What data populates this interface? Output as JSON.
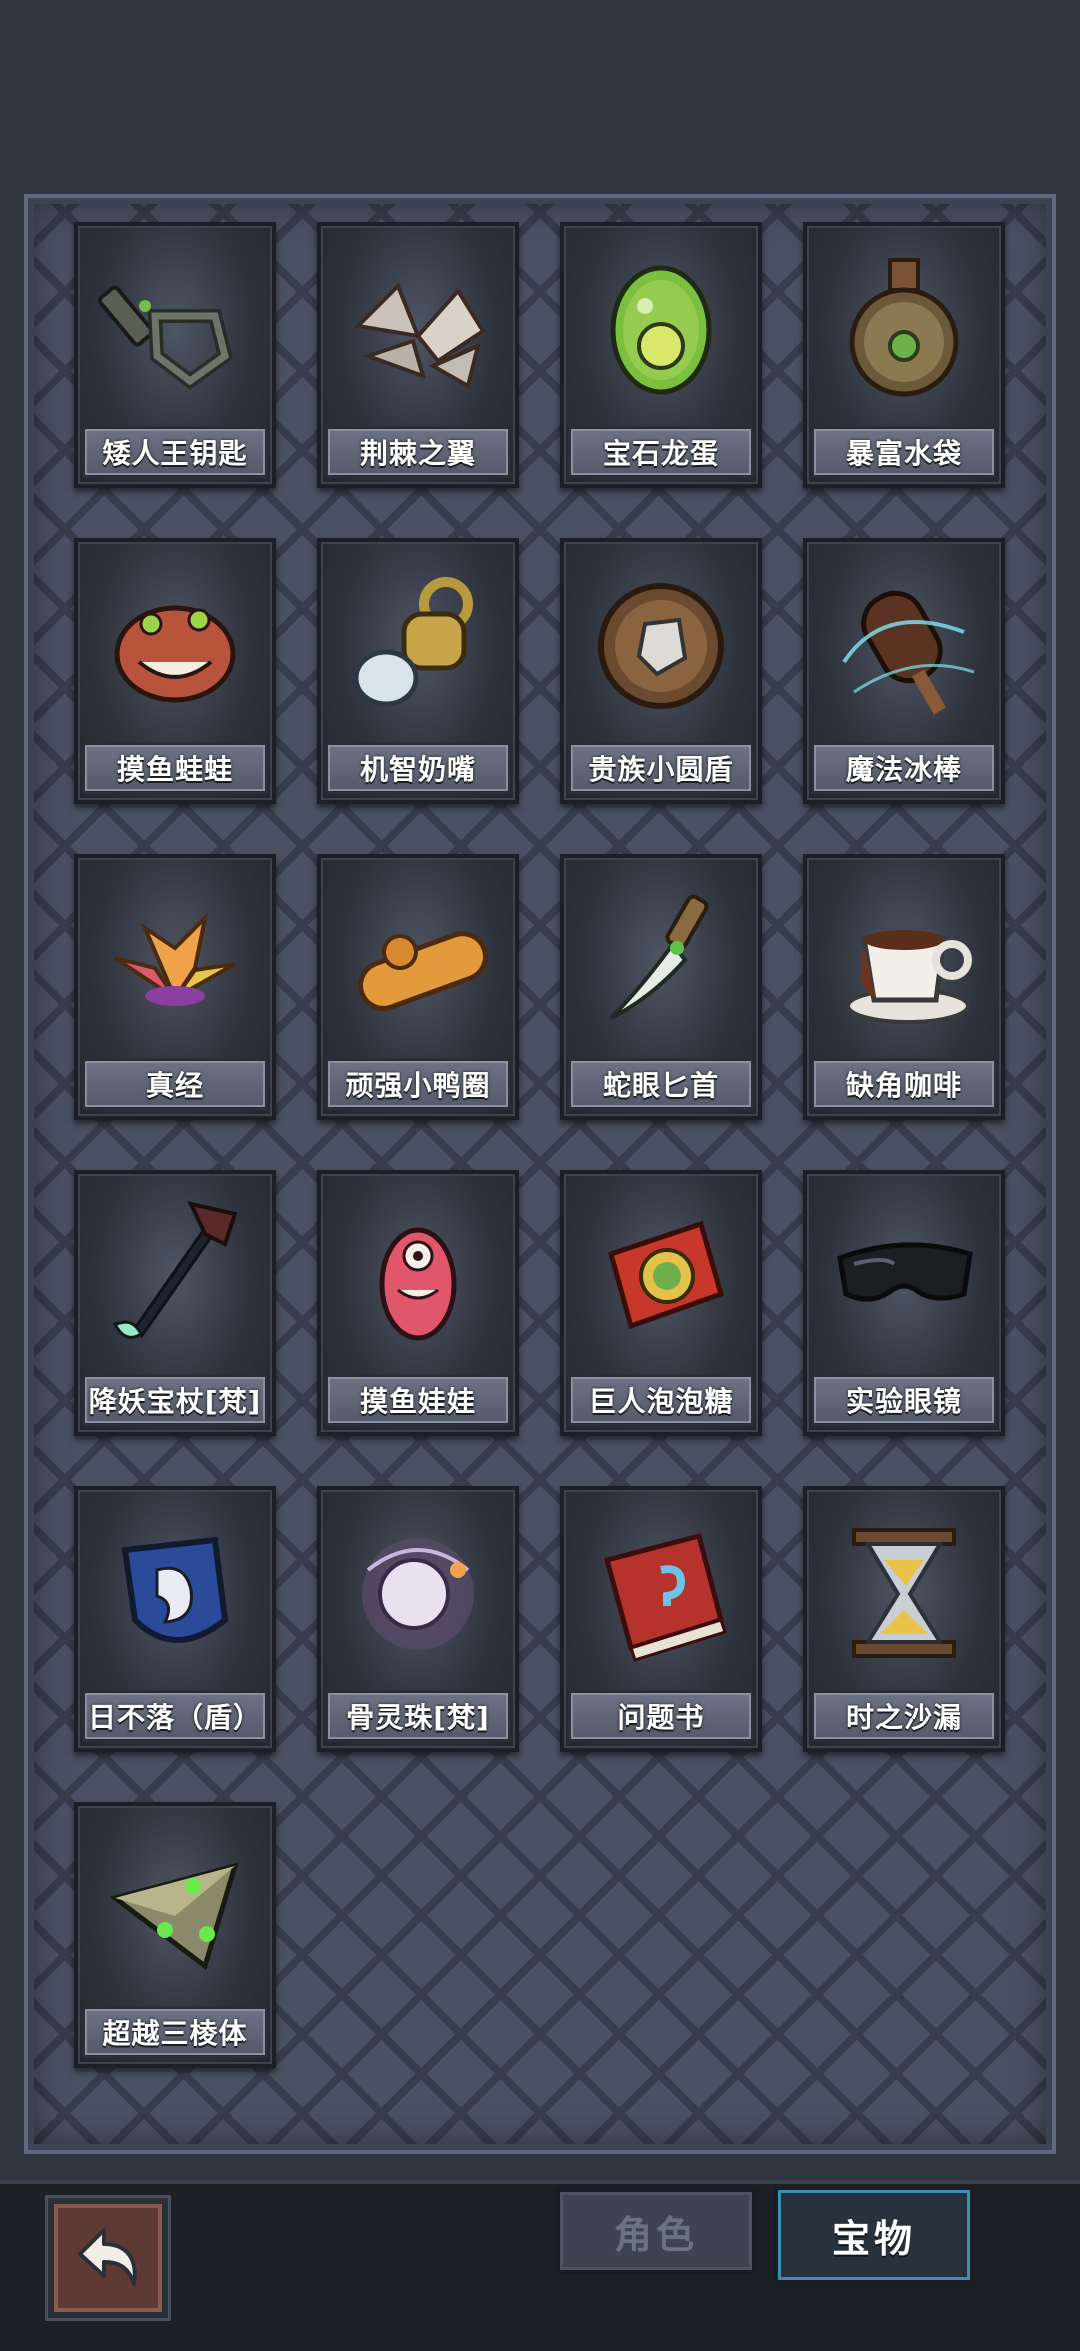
{
  "items": [
    {
      "label": "矮人王钥匙",
      "icon": "dwarf-key-icon"
    },
    {
      "label": "荆棘之翼",
      "icon": "thorn-wings-icon"
    },
    {
      "label": "宝石龙蛋",
      "icon": "gem-dragon-egg-icon"
    },
    {
      "label": "暴富水袋",
      "icon": "water-flask-icon"
    },
    {
      "label": "摸鱼蛙蛙",
      "icon": "slacker-frog-icon"
    },
    {
      "label": "机智奶嘴",
      "icon": "pacifier-icon"
    },
    {
      "label": "贵族小圆盾",
      "icon": "round-shield-icon"
    },
    {
      "label": "魔法冰棒",
      "icon": "magic-popsicle-icon"
    },
    {
      "label": "真经",
      "icon": "lotus-icon"
    },
    {
      "label": "顽强小鸭圈",
      "icon": "duck-ring-icon"
    },
    {
      "label": "蛇眼匕首",
      "icon": "snake-eye-dagger-icon"
    },
    {
      "label": "缺角咖啡",
      "icon": "chipped-coffee-icon"
    },
    {
      "label": "降妖宝杖[梵]",
      "icon": "demon-staff-icon"
    },
    {
      "label": "摸鱼娃娃",
      "icon": "slacker-doll-icon"
    },
    {
      "label": "巨人泡泡糖",
      "icon": "bubble-gum-icon"
    },
    {
      "label": "实验眼镜",
      "icon": "lab-goggles-icon"
    },
    {
      "label": "日不落（盾）",
      "icon": "lion-shield-icon"
    },
    {
      "label": "骨灵珠[梵]",
      "icon": "bone-orb-icon"
    },
    {
      "label": "问题书",
      "icon": "question-book-icon"
    },
    {
      "label": "时之沙漏",
      "icon": "hourglass-icon"
    },
    {
      "label": "超越三棱体",
      "icon": "prism-icon"
    }
  ],
  "tabs": {
    "role": "角色",
    "treasure": "宝物",
    "active": "treasure"
  },
  "back_button": {
    "icon": "back-arrow-icon"
  }
}
